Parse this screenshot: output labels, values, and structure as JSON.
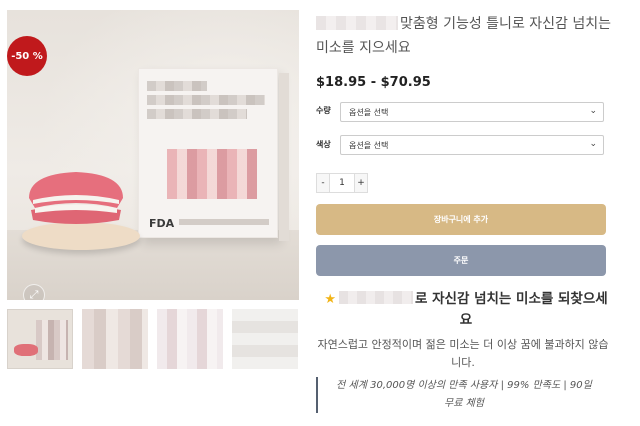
{
  "gallery": {
    "sale_badge": "-50 %",
    "zoom_icon": "expand-icon",
    "box_label": "FDA",
    "thumbnail_count": 4
  },
  "product": {
    "title": "맞춤형 기능성 틀니로 자신감 넘치는 미소를 지으세요",
    "price_range": "$18.95 - $70.95",
    "options": [
      {
        "label": "수량",
        "selected": "옵션을 선택"
      },
      {
        "label": "색상",
        "selected": "옵션을 선택"
      }
    ],
    "quantity": {
      "minus": "-",
      "value": "1",
      "plus": "+"
    },
    "add_to_cart": "장바구니에 추가",
    "order_now": "주문"
  },
  "highlight": {
    "star_icon": "star-icon",
    "title": "로 자신감 넘치는 미소를 되찾으세요",
    "description": "자연스럽고 안정적이며 젊은 미소는 더 이상 꿈에 불과하지 않습니다.",
    "quote": "전 세계 30,000명 이상의 만족 사용자 | 99% 만족도 | 90일 무료 체험"
  },
  "colors": {
    "sale_badge": "#c0191c",
    "cart_button": "#d7b985",
    "order_button": "#8c97ab",
    "star": "#f2b417"
  }
}
